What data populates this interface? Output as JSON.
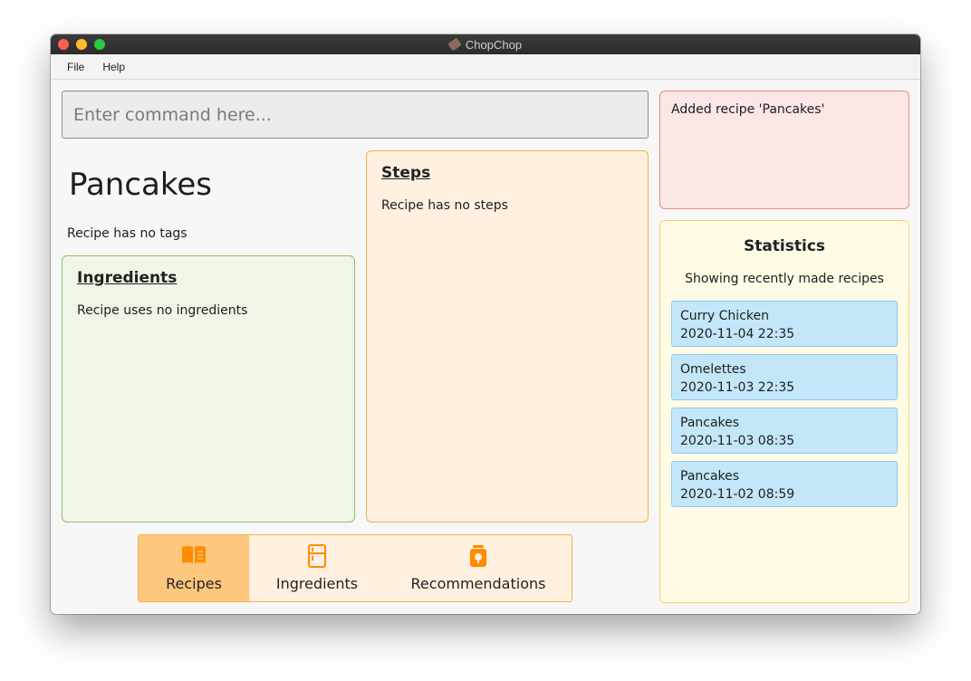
{
  "window": {
    "title": "ChopChop"
  },
  "menu": {
    "file": "File",
    "help": "Help"
  },
  "command": {
    "placeholder": "Enter command here...",
    "value": ""
  },
  "recipe": {
    "name": "Pancakes",
    "tags": "Recipe has no tags",
    "ingredients_heading": "Ingredients",
    "ingredients_text": "Recipe uses no ingredients",
    "steps_heading": "Steps",
    "steps_text": "Recipe has no steps"
  },
  "tabs": [
    {
      "label": "Recipes",
      "icon": "book-icon",
      "active": true
    },
    {
      "label": "Ingredients",
      "icon": "fridge-icon",
      "active": false
    },
    {
      "label": "Recommendations",
      "icon": "jar-icon",
      "active": false
    }
  ],
  "result": {
    "message": "Added recipe 'Pancakes'"
  },
  "statistics": {
    "title": "Statistics",
    "subtitle": "Showing recently made recipes",
    "items": [
      {
        "name": "Curry Chicken",
        "time": "2020-11-04 22:35"
      },
      {
        "name": "Omelettes",
        "time": "2020-11-03 22:35"
      },
      {
        "name": "Pancakes",
        "time": "2020-11-03 08:35"
      },
      {
        "name": "Pancakes",
        "time": "2020-11-02 08:59"
      }
    ]
  },
  "colors": {
    "accent": "#fe8b00",
    "active_tab": "#fec77e",
    "ingredients_bg": "#eff6e8",
    "steps_bg": "#fff0df",
    "result_bg": "#fbe7e6",
    "stats_bg": "#fffbe5",
    "stat_item_bg": "#c3e6f8"
  }
}
